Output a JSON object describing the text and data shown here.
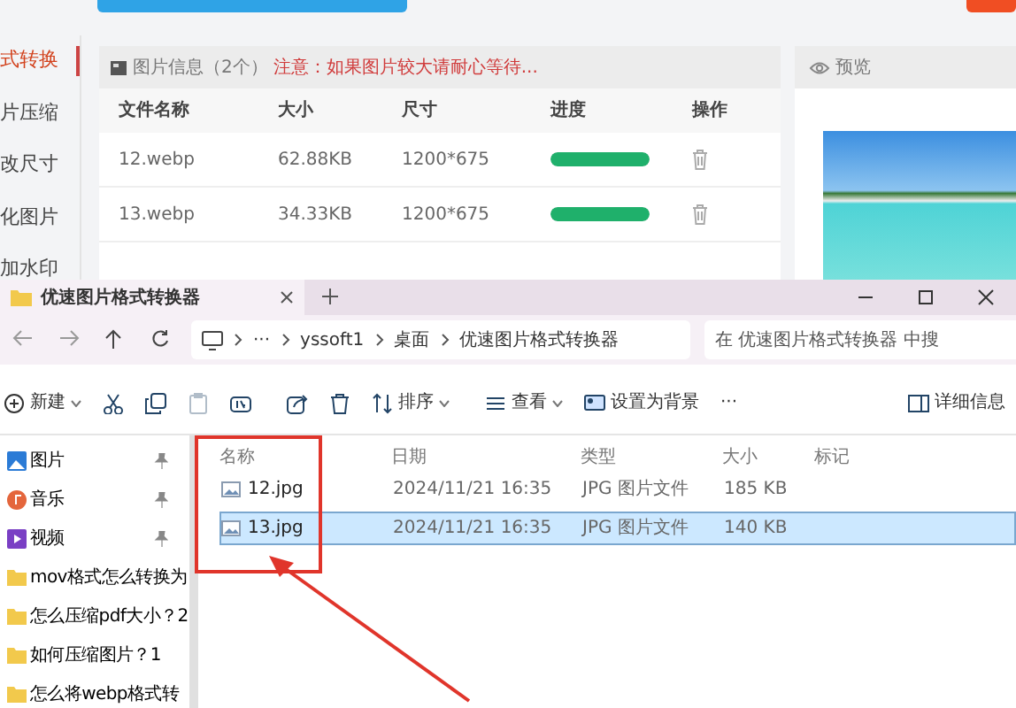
{
  "app": {
    "sidebar": [
      {
        "label": "式转换",
        "selected": true
      },
      {
        "label": "片压缩",
        "selected": false
      },
      {
        "label": "改尺寸",
        "selected": false
      },
      {
        "label": "化图片",
        "selected": false
      },
      {
        "label": "加水印",
        "selected": false
      }
    ],
    "info_panel": {
      "title": "图片信息（2个）",
      "notice": "注意：如果图片较大请耐心等待...",
      "columns": [
        "文件名称",
        "大小",
        "尺寸",
        "进度",
        "操作"
      ],
      "rows": [
        {
          "name": "12.webp",
          "size": "62.88KB",
          "dimensions": "1200*675",
          "level": 1
        },
        {
          "name": "13.webp",
          "size": "34.33KB",
          "dimensions": "1200*675",
          "level": 1
        }
      ]
    },
    "preview": {
      "title": "预览"
    }
  },
  "explorer": {
    "tab": {
      "title": "优速图片格式转换器"
    },
    "breadcrumb": [
      "···",
      "yssoft1",
      "桌面",
      "优速图片格式转换器"
    ],
    "search": {
      "placeholder": "在 优速图片格式转换器 中搜"
    },
    "toolbar": [
      {
        "kind": "new",
        "label": "新建",
        "disabled": false
      },
      {
        "kind": "cut",
        "disabled": false
      },
      {
        "kind": "copy",
        "disabled": false
      },
      {
        "kind": "paste",
        "disabled": true
      },
      {
        "kind": "rename",
        "disabled": false
      },
      {
        "kind": "share",
        "disabled": false
      },
      {
        "kind": "delete",
        "disabled": false
      },
      {
        "kind": "sort",
        "label": "排序",
        "disabled": false
      },
      {
        "kind": "view",
        "label": "查看",
        "disabled": false
      },
      {
        "kind": "background",
        "label": "设置为背景",
        "disabled": false
      },
      {
        "kind": "more",
        "label": "···",
        "disabled": false
      }
    ],
    "details": {
      "label": "详细信息"
    },
    "nav": [
      {
        "kind": "pictures",
        "label": "图片",
        "pinned": true
      },
      {
        "kind": "music",
        "label": "音乐",
        "pinned": true
      },
      {
        "kind": "videos",
        "label": "视频",
        "pinned": true
      },
      {
        "kind": "folder",
        "label": "mov格式怎么转换为",
        "pinned": false
      },
      {
        "kind": "folder",
        "label": "怎么压缩pdf大小？2",
        "pinned": false
      },
      {
        "kind": "folder",
        "label": "如何压缩图片？1",
        "pinned": false
      },
      {
        "kind": "folder",
        "label": "怎么将webp格式转",
        "pinned": false
      }
    ],
    "columns": [
      "名称",
      "日期",
      "类型",
      "大小",
      "标记"
    ],
    "files": [
      {
        "name": "12.jpg",
        "date": "2024/11/21 16:35",
        "type": "JPG 图片文件",
        "size": "185 KB",
        "selected": false
      },
      {
        "name": "13.jpg",
        "date": "2024/11/21 16:35",
        "type": "JPG 图片文件",
        "size": "140 KB",
        "selected": true
      }
    ]
  }
}
